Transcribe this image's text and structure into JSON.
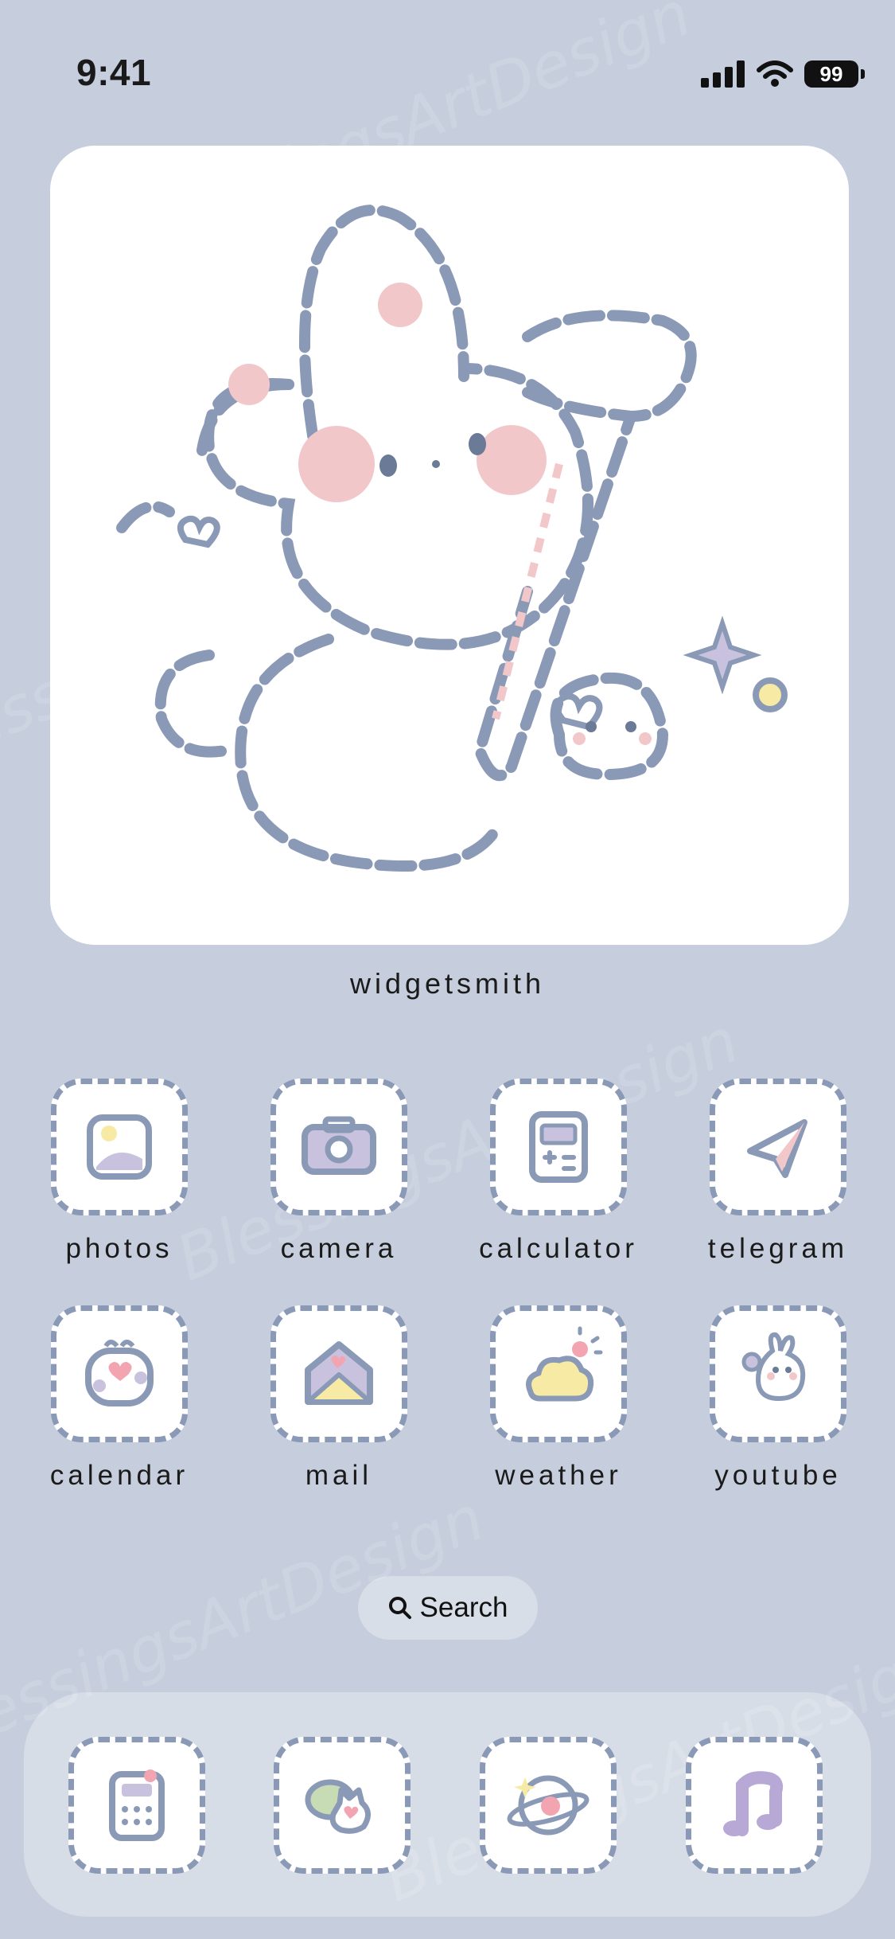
{
  "status_bar": {
    "time": "9:41",
    "battery": "99"
  },
  "widget": {
    "label": "widgetsmith"
  },
  "apps": [
    {
      "label": "photos",
      "icon": "photos-icon"
    },
    {
      "label": "camera",
      "icon": "camera-icon"
    },
    {
      "label": "calculator",
      "icon": "calculator-icon"
    },
    {
      "label": "telegram",
      "icon": "telegram-icon"
    },
    {
      "label": "calendar",
      "icon": "calendar-icon"
    },
    {
      "label": "mail",
      "icon": "mail-icon"
    },
    {
      "label": "weather",
      "icon": "weather-icon"
    },
    {
      "label": "youtube",
      "icon": "youtube-icon"
    }
  ],
  "search": {
    "label": "Search"
  },
  "dock": [
    {
      "icon": "phone-keypad-icon"
    },
    {
      "icon": "messages-icon"
    },
    {
      "icon": "planet-icon"
    },
    {
      "icon": "music-icon"
    }
  ],
  "colors": {
    "background": "#c6cedd",
    "outline": "#8a99b6",
    "blush": "#f2c7c9",
    "yellow": "#f7eaa5",
    "lavender": "#c9c2de"
  },
  "watermark": "BlessingsArtDesign"
}
